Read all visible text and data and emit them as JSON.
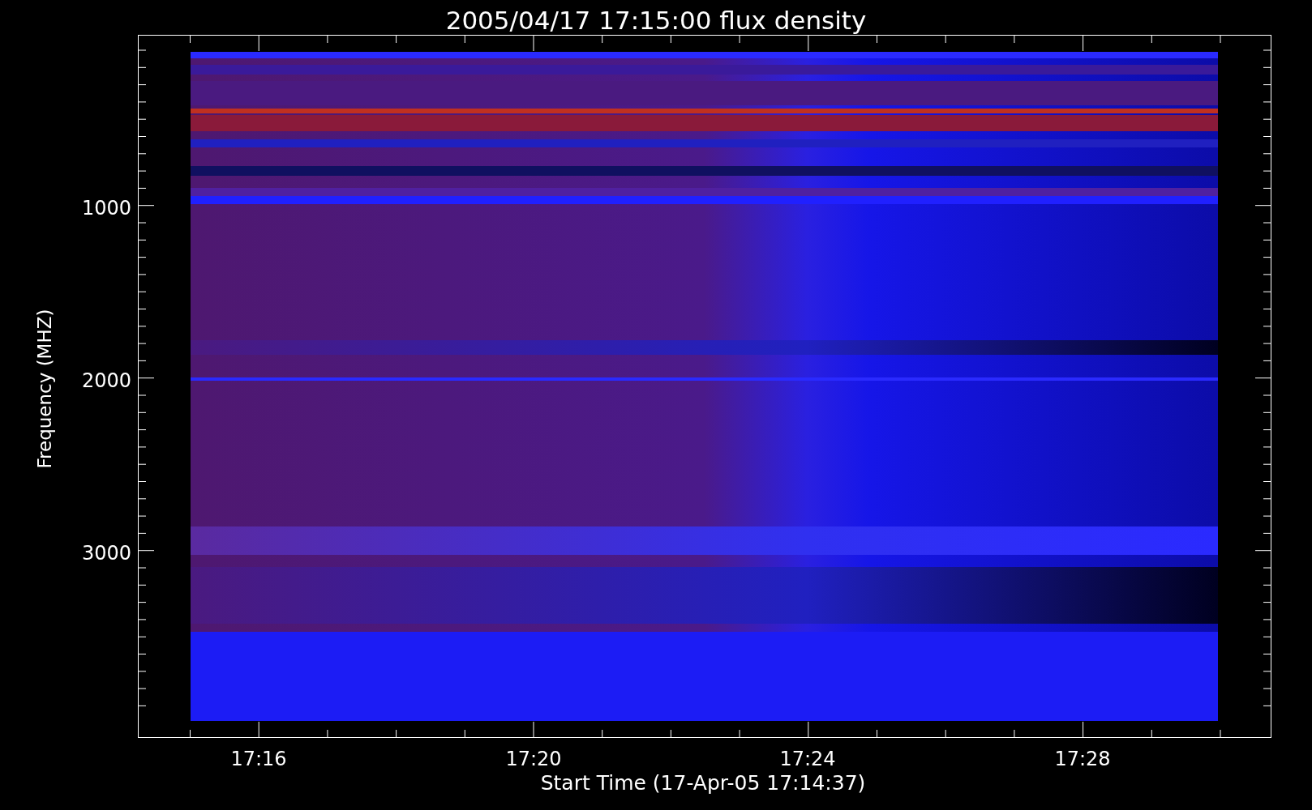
{
  "title": "2005/04/17 17:15:00 flux density",
  "y_axis": {
    "label": "Frequency (MHZ)",
    "ticks": [
      "1000",
      "2000",
      "3000"
    ]
  },
  "x_axis": {
    "label": "Start Time (17-Apr-05 17:14:37)",
    "ticks": [
      "17:16",
      "17:20",
      "17:24",
      "17:28"
    ]
  }
}
